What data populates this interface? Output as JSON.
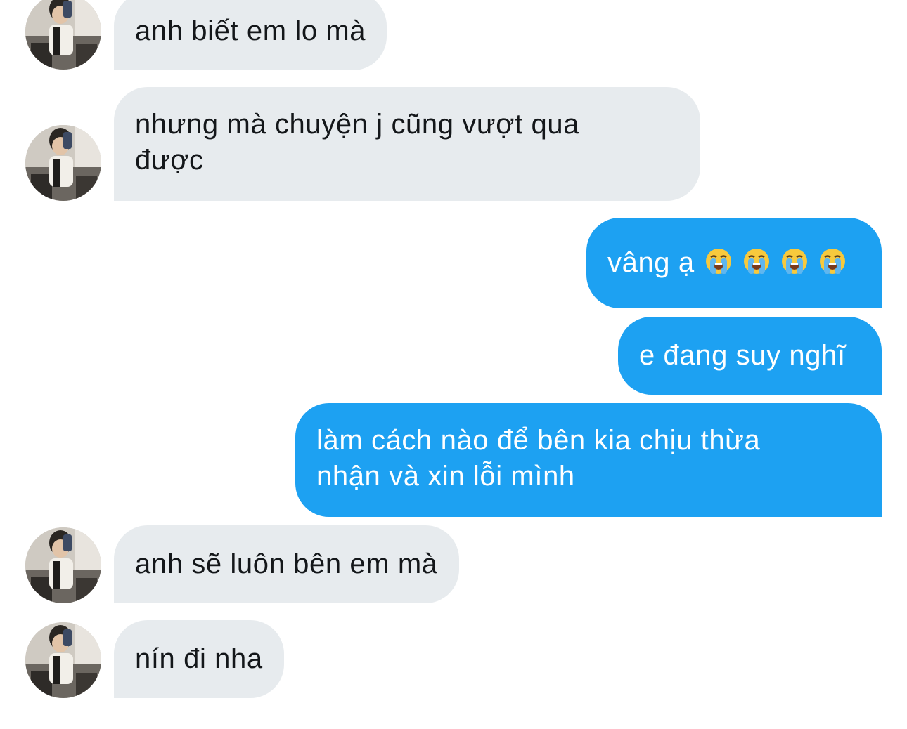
{
  "conversation": {
    "messages": [
      {
        "side": "in",
        "text": "anh biết em lo mà",
        "avatar": "avatar-photo"
      },
      {
        "side": "in",
        "text_lines": [
          "nhưng mà chuyện j cũng vượt qua",
          "được"
        ],
        "avatar": "avatar-photo"
      },
      {
        "side": "out",
        "text": "vâng ạ",
        "emoji": [
          "loudly-crying-face",
          "loudly-crying-face",
          "loudly-crying-face",
          "loudly-crying-face"
        ]
      },
      {
        "side": "out",
        "text": "e đang suy nghĩ"
      },
      {
        "side": "out",
        "text_lines": [
          "làm cách nào để bên kia chịu thừa",
          "nhận và xin lỗi mình"
        ]
      },
      {
        "side": "in",
        "text": "anh sẽ luôn bên em mà",
        "avatar": "avatar-photo"
      },
      {
        "side": "in",
        "text": "nín đi nha",
        "avatar": "avatar-photo"
      }
    ]
  },
  "colors": {
    "incoming_bubble": "#e7ebee",
    "incoming_text": "#14171a",
    "outgoing_bubble": "#1da1f2",
    "outgoing_text": "#ffffff",
    "background": "#ffffff"
  }
}
